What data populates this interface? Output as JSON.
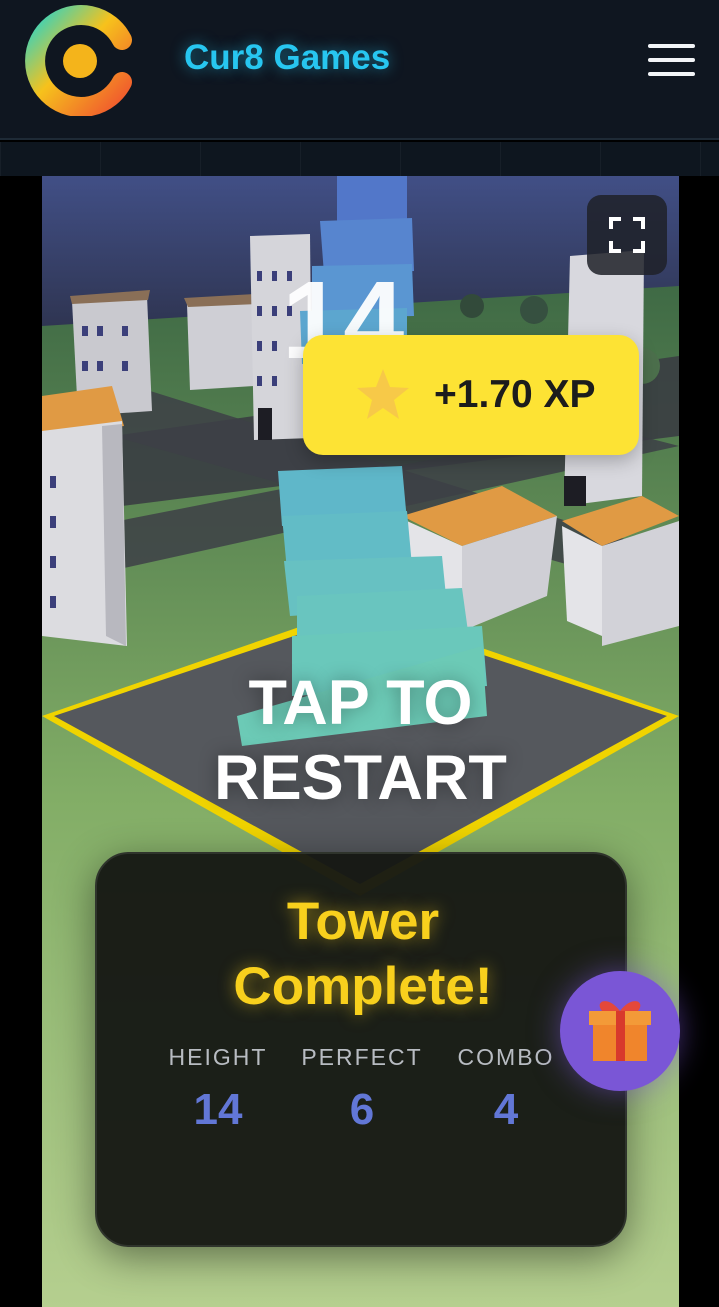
{
  "header": {
    "brand": "Cur8 Games",
    "logo_icon": "cur8-logo-icon",
    "menu_icon": "hamburger-menu-icon"
  },
  "game": {
    "score": "14",
    "fullscreen_icon": "fullscreen-icon",
    "xp_toast": {
      "icon": "star-icon",
      "text": "+1.70 XP"
    },
    "restart_line1": "TAP TO",
    "restart_line2": "RESTART",
    "result": {
      "title_line1": "Tower",
      "title_line2": "Complete!",
      "stats": [
        {
          "label": "HEIGHT",
          "value": "14"
        },
        {
          "label": "PERFECT",
          "value": "6"
        },
        {
          "label": "COMBO",
          "value": "4"
        }
      ]
    },
    "gift_icon": "gift-icon"
  },
  "colors": {
    "header_bg": "#0f1620",
    "brand_text": "#27c6f0",
    "toast_bg": "#fde334",
    "result_title": "#f8d01d",
    "stat_value": "#6277d6",
    "gift_button": "#7a56d6"
  }
}
